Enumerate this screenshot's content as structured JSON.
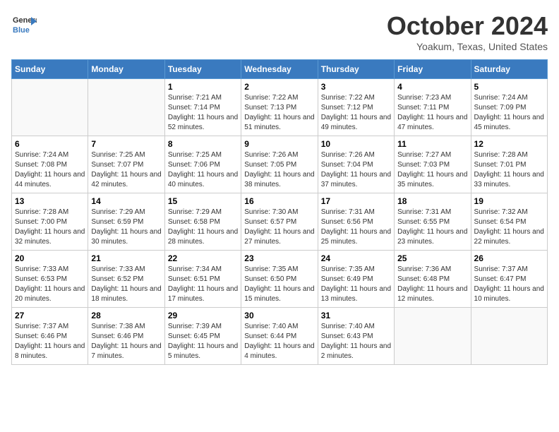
{
  "header": {
    "logo_line1": "General",
    "logo_line2": "Blue",
    "month_title": "October 2024",
    "location": "Yoakum, Texas, United States"
  },
  "days_of_week": [
    "Sunday",
    "Monday",
    "Tuesday",
    "Wednesday",
    "Thursday",
    "Friday",
    "Saturday"
  ],
  "weeks": [
    [
      {
        "day": "",
        "empty": true,
        "content": ""
      },
      {
        "day": "",
        "empty": true,
        "content": ""
      },
      {
        "day": "1",
        "empty": false,
        "content": "Sunrise: 7:21 AM\nSunset: 7:14 PM\nDaylight: 11 hours and 52 minutes."
      },
      {
        "day": "2",
        "empty": false,
        "content": "Sunrise: 7:22 AM\nSunset: 7:13 PM\nDaylight: 11 hours and 51 minutes."
      },
      {
        "day": "3",
        "empty": false,
        "content": "Sunrise: 7:22 AM\nSunset: 7:12 PM\nDaylight: 11 hours and 49 minutes."
      },
      {
        "day": "4",
        "empty": false,
        "content": "Sunrise: 7:23 AM\nSunset: 7:11 PM\nDaylight: 11 hours and 47 minutes."
      },
      {
        "day": "5",
        "empty": false,
        "content": "Sunrise: 7:24 AM\nSunset: 7:09 PM\nDaylight: 11 hours and 45 minutes."
      }
    ],
    [
      {
        "day": "6",
        "empty": false,
        "content": "Sunrise: 7:24 AM\nSunset: 7:08 PM\nDaylight: 11 hours and 44 minutes."
      },
      {
        "day": "7",
        "empty": false,
        "content": "Sunrise: 7:25 AM\nSunset: 7:07 PM\nDaylight: 11 hours and 42 minutes."
      },
      {
        "day": "8",
        "empty": false,
        "content": "Sunrise: 7:25 AM\nSunset: 7:06 PM\nDaylight: 11 hours and 40 minutes."
      },
      {
        "day": "9",
        "empty": false,
        "content": "Sunrise: 7:26 AM\nSunset: 7:05 PM\nDaylight: 11 hours and 38 minutes."
      },
      {
        "day": "10",
        "empty": false,
        "content": "Sunrise: 7:26 AM\nSunset: 7:04 PM\nDaylight: 11 hours and 37 minutes."
      },
      {
        "day": "11",
        "empty": false,
        "content": "Sunrise: 7:27 AM\nSunset: 7:03 PM\nDaylight: 11 hours and 35 minutes."
      },
      {
        "day": "12",
        "empty": false,
        "content": "Sunrise: 7:28 AM\nSunset: 7:01 PM\nDaylight: 11 hours and 33 minutes."
      }
    ],
    [
      {
        "day": "13",
        "empty": false,
        "content": "Sunrise: 7:28 AM\nSunset: 7:00 PM\nDaylight: 11 hours and 32 minutes."
      },
      {
        "day": "14",
        "empty": false,
        "content": "Sunrise: 7:29 AM\nSunset: 6:59 PM\nDaylight: 11 hours and 30 minutes."
      },
      {
        "day": "15",
        "empty": false,
        "content": "Sunrise: 7:29 AM\nSunset: 6:58 PM\nDaylight: 11 hours and 28 minutes."
      },
      {
        "day": "16",
        "empty": false,
        "content": "Sunrise: 7:30 AM\nSunset: 6:57 PM\nDaylight: 11 hours and 27 minutes."
      },
      {
        "day": "17",
        "empty": false,
        "content": "Sunrise: 7:31 AM\nSunset: 6:56 PM\nDaylight: 11 hours and 25 minutes."
      },
      {
        "day": "18",
        "empty": false,
        "content": "Sunrise: 7:31 AM\nSunset: 6:55 PM\nDaylight: 11 hours and 23 minutes."
      },
      {
        "day": "19",
        "empty": false,
        "content": "Sunrise: 7:32 AM\nSunset: 6:54 PM\nDaylight: 11 hours and 22 minutes."
      }
    ],
    [
      {
        "day": "20",
        "empty": false,
        "content": "Sunrise: 7:33 AM\nSunset: 6:53 PM\nDaylight: 11 hours and 20 minutes."
      },
      {
        "day": "21",
        "empty": false,
        "content": "Sunrise: 7:33 AM\nSunset: 6:52 PM\nDaylight: 11 hours and 18 minutes."
      },
      {
        "day": "22",
        "empty": false,
        "content": "Sunrise: 7:34 AM\nSunset: 6:51 PM\nDaylight: 11 hours and 17 minutes."
      },
      {
        "day": "23",
        "empty": false,
        "content": "Sunrise: 7:35 AM\nSunset: 6:50 PM\nDaylight: 11 hours and 15 minutes."
      },
      {
        "day": "24",
        "empty": false,
        "content": "Sunrise: 7:35 AM\nSunset: 6:49 PM\nDaylight: 11 hours and 13 minutes."
      },
      {
        "day": "25",
        "empty": false,
        "content": "Sunrise: 7:36 AM\nSunset: 6:48 PM\nDaylight: 11 hours and 12 minutes."
      },
      {
        "day": "26",
        "empty": false,
        "content": "Sunrise: 7:37 AM\nSunset: 6:47 PM\nDaylight: 11 hours and 10 minutes."
      }
    ],
    [
      {
        "day": "27",
        "empty": false,
        "content": "Sunrise: 7:37 AM\nSunset: 6:46 PM\nDaylight: 11 hours and 8 minutes."
      },
      {
        "day": "28",
        "empty": false,
        "content": "Sunrise: 7:38 AM\nSunset: 6:46 PM\nDaylight: 11 hours and 7 minutes."
      },
      {
        "day": "29",
        "empty": false,
        "content": "Sunrise: 7:39 AM\nSunset: 6:45 PM\nDaylight: 11 hours and 5 minutes."
      },
      {
        "day": "30",
        "empty": false,
        "content": "Sunrise: 7:40 AM\nSunset: 6:44 PM\nDaylight: 11 hours and 4 minutes."
      },
      {
        "day": "31",
        "empty": false,
        "content": "Sunrise: 7:40 AM\nSunset: 6:43 PM\nDaylight: 11 hours and 2 minutes."
      },
      {
        "day": "",
        "empty": true,
        "content": ""
      },
      {
        "day": "",
        "empty": true,
        "content": ""
      }
    ]
  ]
}
